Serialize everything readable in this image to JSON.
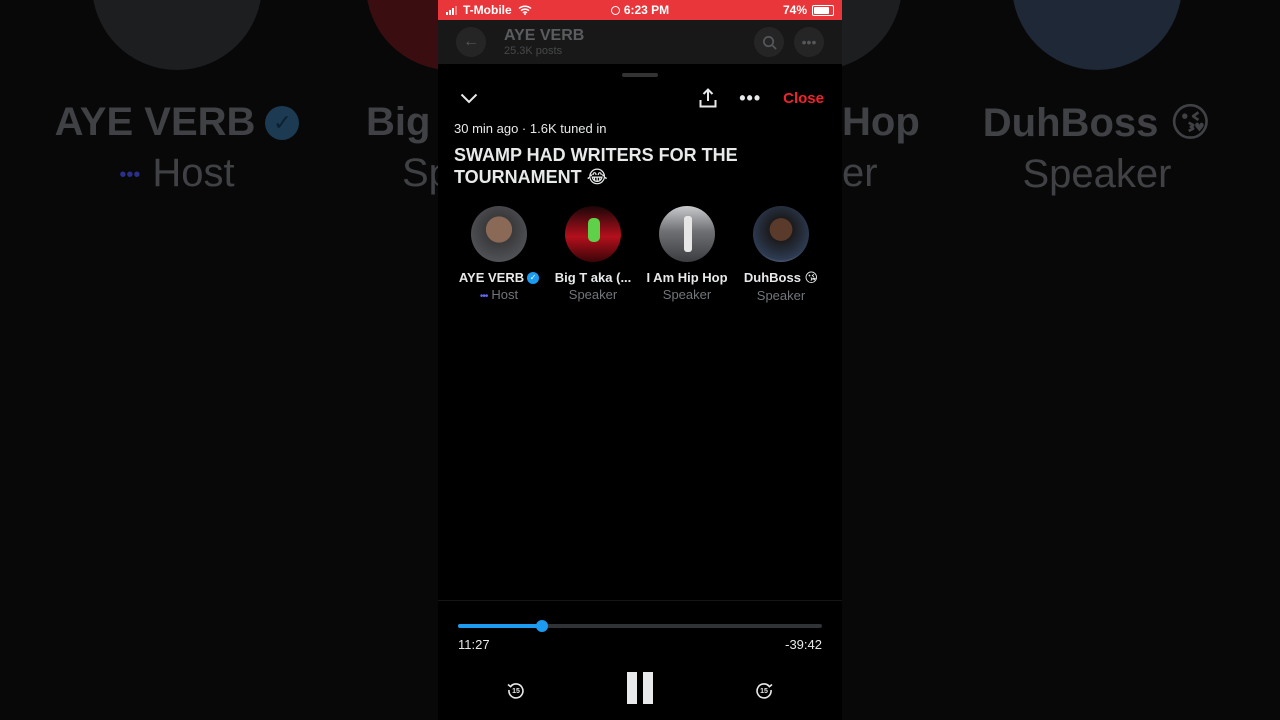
{
  "status_bar": {
    "carrier": "T-Mobile",
    "time": "6:23 PM",
    "battery": "74%"
  },
  "profile_header": {
    "name": "AYE VERB",
    "posts": "25.3K posts"
  },
  "space": {
    "close_label": "Close",
    "meta": "30 min ago · 1.6K tuned in",
    "title": "SWAMP HAD WRITERS FOR THE TOURNAMENT 😂",
    "speakers": [
      {
        "name": "AYE VERB",
        "role": "Host",
        "verified": true
      },
      {
        "name": "Big T aka (...",
        "role": "Speaker"
      },
      {
        "name": "I Am Hip Hop",
        "role": "Speaker"
      },
      {
        "name": "DuhBoss 😘",
        "role": "Speaker"
      }
    ]
  },
  "background": {
    "speakers": [
      {
        "name": "AYE VERB",
        "role": "Host"
      },
      {
        "name": "Big",
        "role": "Sp"
      },
      {
        "name": "Hop",
        "role": "er"
      },
      {
        "name": "DuhBoss 😘",
        "role": "Speaker"
      }
    ]
  },
  "playback": {
    "elapsed": "11:27",
    "remaining": "-39:42",
    "progress": 0.23
  },
  "colors": {
    "accent": "#1d9bf0",
    "close": "#f4212e",
    "status_bar": "#e8363b",
    "host_dots": "#6167f6"
  },
  "icons": {
    "back": "arrow-left-icon",
    "search": "search-icon",
    "more": "ellipsis-icon",
    "minimize": "chevron-down-icon",
    "share": "share-icon",
    "rewind": "rewind-15-icon",
    "pause": "pause-icon",
    "forward": "forward-15-icon"
  }
}
